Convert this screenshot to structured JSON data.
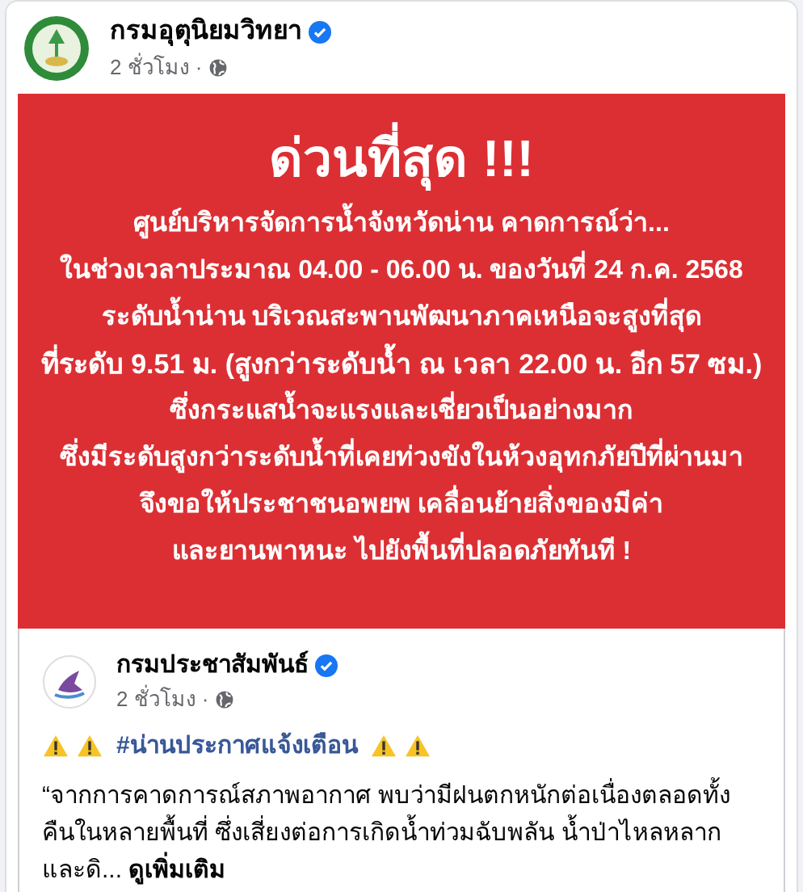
{
  "post": {
    "author": "กรมอุตุนิยมวิทยา",
    "verified": true,
    "time": "2 ชั่วโมง",
    "separator": "·"
  },
  "poster": {
    "headline": "ด่วนที่สุด !!!",
    "lines": [
      "ศูนย์บริหารจัดการน้ำจังหวัดน่าน คาดการณ์ว่า...",
      "ในช่วงเวลาประมาณ 04.00 - 06.00 น. ของวันที่ 24 ก.ค. 2568",
      "ระดับน้ำน่าน บริเวณสะพานพัฒนาภาคเหนือจะสูงที่สุด",
      "ที่ระดับ 9.51 ม. (สูงกว่าระดับน้ำ ณ เวลา 22.00 น. อีก 57 ซม.)",
      "ซึ่งกระแสน้ำจะแรงและเชี่ยวเป็นอย่างมาก",
      "ซึ่งมีระดับสูงกว่าระดับน้ำที่เคยท่วงขังในห้วงอุทกภัยปีที่ผ่านมา",
      "จึงขอให้ประชาชนอพยพ เคลื่อนย้ายสิ่งของมีค่า",
      "และยานพาหนะ ไปยังพื้นที่ปลอดภัยทันที !"
    ]
  },
  "shared_post": {
    "author": "กรมประชาสัมพันธ์",
    "verified": true,
    "time": "2 ชั่วโมง",
    "separator": "·",
    "hashtag": "#น่านประกาศแจ้งเตือน",
    "body": "“จากการคาดการณ์สภาพอากาศ พบว่ามีฝนตกหนักต่อเนื่องตลอดทั้งคืนในหลายพื้นที่ ซึ่งเสี่ยงต่อการเกิดน้ำท่วมฉับพลัน น้ำป่าไหลหลาก และดิ...",
    "see_more": "ดูเพิ่มเติม"
  }
}
